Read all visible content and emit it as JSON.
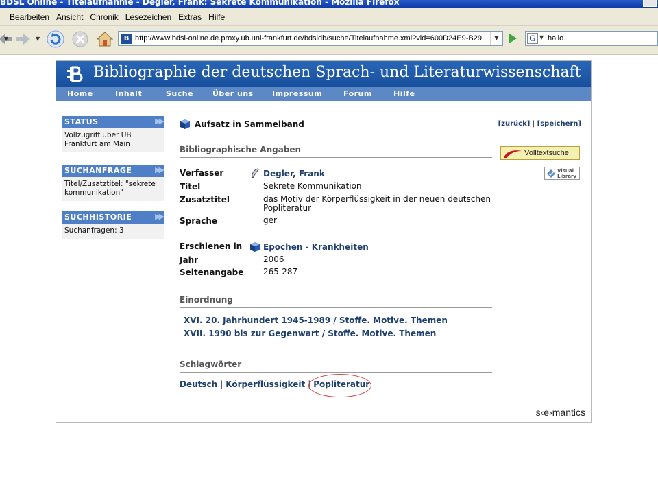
{
  "browser": {
    "window_title": "BDSL Online - Titelaufnahme - Degler, Frank: Sekrete Kommunikation - Mozilla Firefox",
    "menu": [
      "Bearbeiten",
      "Ansicht",
      "Chronik",
      "Lesezeichen",
      "Extras",
      "Hilfe"
    ],
    "url": "http://www.bdsl-online.de.proxy.ub.uni-frankfurt.de/bdsldb/suche/Titelaufnahme.xml?vid=600D24E9-B29",
    "search_value": "hallo"
  },
  "site": {
    "title": "Bibliographie der deutschen Sprach- und Literaturwissenschaft",
    "nav": [
      "Home",
      "Inhalt",
      "Suche",
      "Über uns",
      "Impressum",
      "Forum",
      "Hilfe"
    ]
  },
  "sidebar": {
    "status_head": "STATUS",
    "status_body": "Vollzugriff über UB Frankfurt am Main",
    "query_head": "SUCHANFRAGE",
    "query_body": "Titel/Zusatztitel: \"sekrete kommunikation\"",
    "history_head": "SUCHHISTORIE",
    "history_body": "Suchanfragen: 3"
  },
  "record": {
    "pub_type": "Aufsatz in Sammelband",
    "back_link": "[zurück]",
    "separator": "|",
    "save_link": "[speichern]",
    "section_biblio": "Bibliographische Angaben",
    "author_label": "Verfasser",
    "author_value": "Degler, Frank",
    "title_label": "Titel",
    "title_value": "Sekrete Kommunikation",
    "subtitle_label": "Zusatztitel",
    "subtitle_value": "das Motiv der Körperflüssigkeit in der neuen deutschen Popliteratur",
    "lang_label": "Sprache",
    "lang_value": "ger",
    "in_label": "Erschienen in",
    "in_value": "Epochen - Krankheiten",
    "year_label": "Jahr",
    "year_value": "2006",
    "pages_label": "Seitenangabe",
    "pages_value": "265-287",
    "section_class": "Einordnung",
    "class_1": "XVI. 20. Jahrhundert 1945-1989 / Stoffe. Motive. Themen",
    "class_2": "XVII. 1990 bis zur Gegenwart / Stoffe. Motive. Themen",
    "section_keywords": "Schlagwörter",
    "keywords": [
      "Deutsch",
      "Körperflüssigkeit",
      "Popliteratur"
    ]
  },
  "aside": {
    "fulltext_button": "Volltextsuche",
    "visual_library": "Visual Library"
  },
  "footer": {
    "brand": "s‹e›mantics"
  },
  "colors": {
    "banner": "#1f59a8",
    "nav": "#5d88c6",
    "link": "#1f3f6f",
    "highlight_circle": "#d84242"
  }
}
